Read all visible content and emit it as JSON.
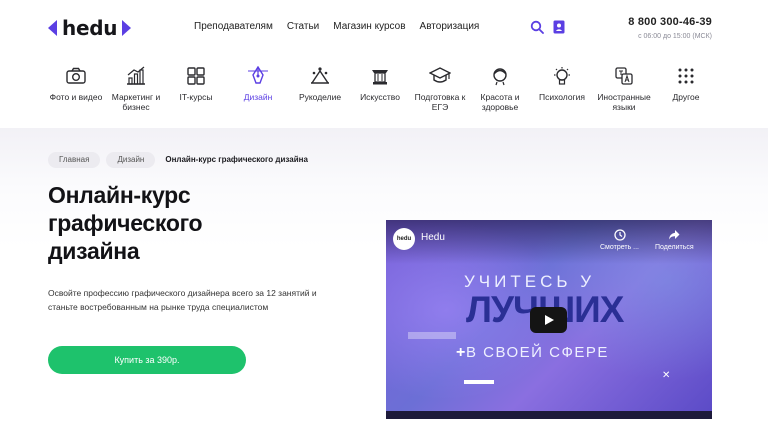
{
  "header": {
    "logo_text": "hedu",
    "nav": [
      "Преподавателям",
      "Статьи",
      "Магазин курсов",
      "Авторизация"
    ],
    "icons": [
      "search-icon",
      "contact-book-icon"
    ],
    "phone": "8 800 300-46-39",
    "hours": "с 06:00 до 15:00 (МСК)",
    "accent_color": "#5b3fe3"
  },
  "categories": [
    {
      "label": "Фото и видео",
      "icon": "camera-icon",
      "active": false
    },
    {
      "label": "Маркетинг и бизнес",
      "icon": "bar-chart-icon",
      "active": false
    },
    {
      "label": "IT-курсы",
      "icon": "it-blocks-icon",
      "active": false
    },
    {
      "label": "Дизайн",
      "icon": "pen-tool-icon",
      "active": true
    },
    {
      "label": "Рукоделие",
      "icon": "crafts-icon",
      "active": false
    },
    {
      "label": "Искусство",
      "icon": "column-icon",
      "active": false
    },
    {
      "label": "Подготовка к ЕГЭ",
      "icon": "graduation-cap-icon",
      "active": false
    },
    {
      "label": "Красота и здоровье",
      "icon": "face-icon",
      "active": false
    },
    {
      "label": "Психология",
      "icon": "lightbulb-icon",
      "active": false
    },
    {
      "label": "Иностранные языки",
      "icon": "translate-icon",
      "active": false
    },
    {
      "label": "Другое",
      "icon": "grid-dots-icon",
      "active": false
    }
  ],
  "breadcrumbs": [
    "Главная",
    "Дизайн",
    "Онлайн-курс графического дизайна"
  ],
  "hero": {
    "title_lines": [
      "Онлайн-курс",
      "графического",
      "дизайна"
    ],
    "description": "Освойте профессию графического дизайнера всего за 12 занятий и станьте востребованным на рынке труда специалистом",
    "buy_label": "Купить за 390р.",
    "buy_color": "#1ec26c"
  },
  "video": {
    "logo_text": "hedu",
    "channel_name": "Hedu",
    "watch_later": "Смотреть ...",
    "share": "Поделиться",
    "line1": "УЧИТЕСЬ У",
    "line2": "ЛУЧШИХ",
    "line3": "В СВОЕЙ СФЕРЕ"
  }
}
